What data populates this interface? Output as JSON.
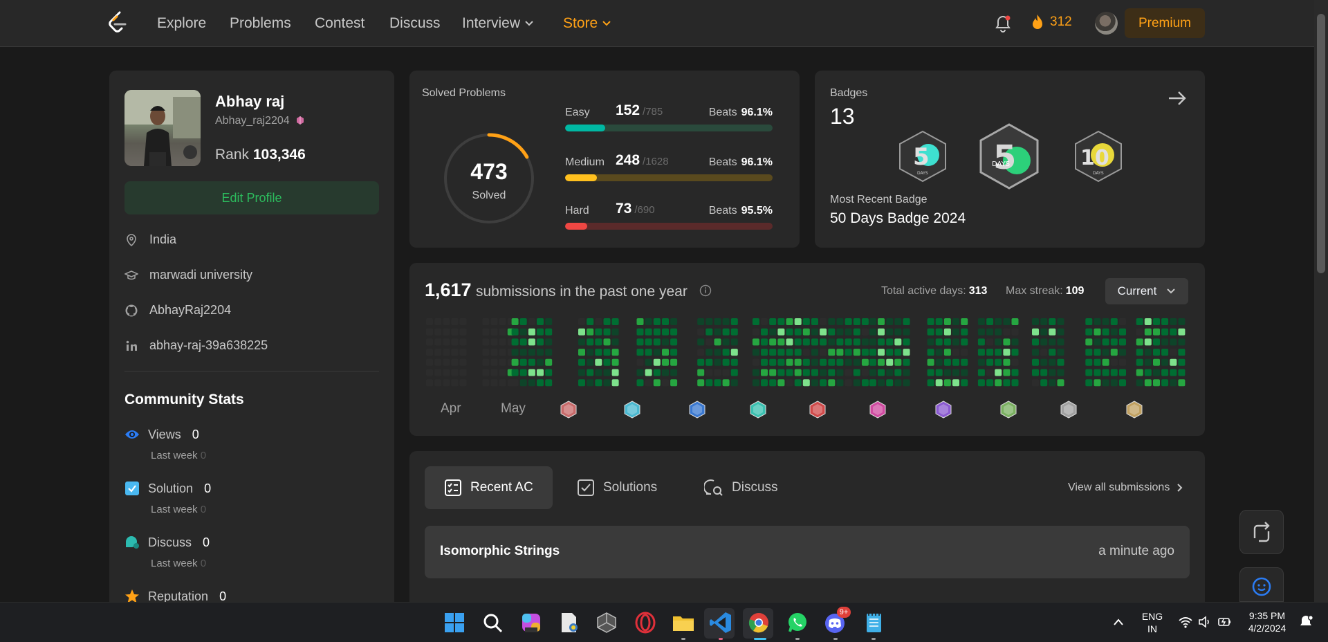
{
  "nav": {
    "items": [
      "Explore",
      "Problems",
      "Contest",
      "Discuss",
      "Interview",
      "Store"
    ],
    "streak": "312",
    "premium": "Premium"
  },
  "profile": {
    "name": "Abhay raj",
    "username": "Abhay_raj2204",
    "rank_label": "Rank",
    "rank_value": "103,346",
    "edit": "Edit Profile",
    "location": "India",
    "school": "marwadi university",
    "github": "AbhayRaj2204",
    "linkedin": "abhay-raj-39a638225"
  },
  "community": {
    "title": "Community Stats",
    "stats": [
      {
        "label": "Views",
        "value": "0",
        "sub_label": "Last week",
        "sub_value": "0"
      },
      {
        "label": "Solution",
        "value": "0",
        "sub_label": "Last week",
        "sub_value": "0"
      },
      {
        "label": "Discuss",
        "value": "0",
        "sub_label": "Last week",
        "sub_value": "0"
      },
      {
        "label": "Reputation",
        "value": "0"
      }
    ]
  },
  "solved": {
    "title": "Solved Problems",
    "total": "473",
    "total_label": "Solved",
    "progress_fraction": 0.168,
    "difficulties": [
      {
        "name": "Easy",
        "solved": "152",
        "total": "/785",
        "beats_label": "Beats",
        "beats": "96.1%",
        "fraction": 0.194,
        "color": "#00b8a3",
        "track": "#2a4a3c"
      },
      {
        "name": "Medium",
        "solved": "248",
        "total": "/1628",
        "beats_label": "Beats",
        "beats": "96.1%",
        "fraction": 0.152,
        "color": "#ffc01e",
        "track": "#5a4a1e"
      },
      {
        "name": "Hard",
        "solved": "73",
        "total": "/690",
        "beats_label": "Beats",
        "beats": "95.5%",
        "fraction": 0.106,
        "color": "#ef4743",
        "track": "#5a2a2a"
      }
    ]
  },
  "badges": {
    "title": "Badges",
    "count": "13",
    "recent_label": "Most Recent Badge",
    "recent": "50 Days Badge 2024",
    "badge_labels": [
      "DAYS",
      "DAYS",
      "DAYS"
    ]
  },
  "heatmap": {
    "count": "1,617",
    "text": "submissions in the past one year",
    "active_label": "Total active days:",
    "active_value": "313",
    "streak_label": "Max streak:",
    "streak_value": "109",
    "select": "Current",
    "months": [
      "Apr",
      "May"
    ]
  },
  "recent": {
    "tabs": [
      "Recent AC",
      "Solutions",
      "Discuss"
    ],
    "view_all": "View all submissions",
    "rows": [
      {
        "title": "Isomorphic Strings",
        "time": "a minute ago"
      }
    ]
  },
  "taskbar": {
    "lang_top": "ENG",
    "lang_bottom": "IN",
    "time": "9:35 PM",
    "date": "4/2/2024",
    "discord_badge": "9+"
  },
  "colors": {
    "accent": "#ffa116",
    "green": "#2cbb5d",
    "background": "#1a1a1a",
    "card": "#282828"
  }
}
